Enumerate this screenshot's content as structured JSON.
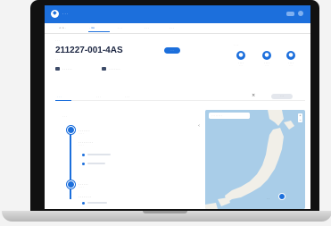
{
  "app": {
    "name": "· · ·"
  },
  "tabs": [
    {
      "label": "< > ·",
      "active": false
    },
    {
      "label": "· 4A",
      "active": true
    },
    {
      "label": "· · ·",
      "active": false
    },
    {
      "label": "· · ·",
      "active": false
    },
    {
      "label": "· · ·",
      "active": false
    }
  ],
  "header": {
    "breadcrumb": "· · ·",
    "title": "211227-001-4AS",
    "badge": "· · ·",
    "subtitle": "· · ·",
    "meta_1": "· · · · · ·",
    "meta_2": "· · · · · · ·"
  },
  "progress": {
    "label": "· · ·",
    "steps": [
      {
        "label": "· · · ·",
        "sub": "· · ·"
      },
      {
        "label": "· · · ·",
        "sub": "· · ·"
      },
      {
        "label": "· · · ·",
        "sub": "· · ·"
      }
    ]
  },
  "subtabs": [
    {
      "label": "· · ·",
      "active": true
    },
    {
      "label": "· · ·",
      "active": false
    },
    {
      "label": "· · ·",
      "active": false
    }
  ],
  "action": {
    "label": "· · ·"
  },
  "timeline": {
    "title": "· · ·",
    "events": [
      {
        "title": "· · · · · · ·",
        "sub": "· · · ·"
      },
      {
        "title": "· · · · · · · · ·",
        "sub": "· · · ·"
      },
      {
        "title": "· · · · · ·",
        "sub": "· · · ·"
      },
      {
        "title": "· · · · · · · ·",
        "sub": ""
      }
    ]
  },
  "map": {
    "search_placeholder": "· · · · · · · ·",
    "place_label": "· ·"
  },
  "colors": {
    "accent": "#1c6fdc",
    "sea": "#a9cde8",
    "land": "#f1efe8"
  }
}
